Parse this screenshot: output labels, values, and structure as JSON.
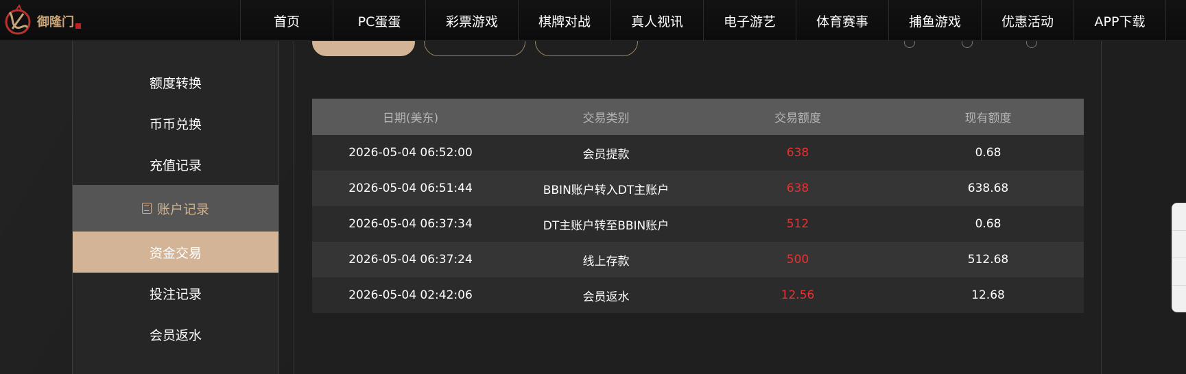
{
  "brand": {
    "name": "御隆门"
  },
  "nav": [
    {
      "label": "首页"
    },
    {
      "label": "PC蛋蛋"
    },
    {
      "label": "彩票游戏"
    },
    {
      "label": "棋牌对战"
    },
    {
      "label": "真人视讯"
    },
    {
      "label": "电子游艺"
    },
    {
      "label": "体育赛事"
    },
    {
      "label": "捕鱼游戏"
    },
    {
      "label": "优惠活动"
    },
    {
      "label": "APP下载"
    }
  ],
  "sidebar": {
    "items": [
      {
        "label": "额度转换"
      },
      {
        "label": "币币兑换"
      },
      {
        "label": "充值记录"
      },
      {
        "label": "账户记录",
        "icon": "ledger-icon"
      },
      {
        "label": "资金交易"
      },
      {
        "label": "投注记录"
      },
      {
        "label": "会员返水"
      }
    ]
  },
  "table": {
    "headers": [
      "日期(美东)",
      "交易类别",
      "交易额度",
      "现有额度"
    ],
    "rows": [
      {
        "date": "2026-05-04 06:52:00",
        "type": "会员提款",
        "amount": "638",
        "balance": "0.68"
      },
      {
        "date": "2026-05-04 06:51:44",
        "type": "BBIN账户转入DT主账户",
        "amount": "638",
        "balance": "638.68"
      },
      {
        "date": "2026-05-04 06:37:34",
        "type": "DT主账户转至BBIN账户",
        "amount": "512",
        "balance": "0.68"
      },
      {
        "date": "2026-05-04 06:37:24",
        "type": "线上存款",
        "amount": "500",
        "balance": "512.68"
      },
      {
        "date": "2026-05-04 02:42:06",
        "type": "会员返水",
        "amount": "12.56",
        "balance": "12.68"
      }
    ]
  },
  "colors": {
    "accent": "#d4b496",
    "amount": "#e63232",
    "nav_bg": "#0f0f0f"
  }
}
